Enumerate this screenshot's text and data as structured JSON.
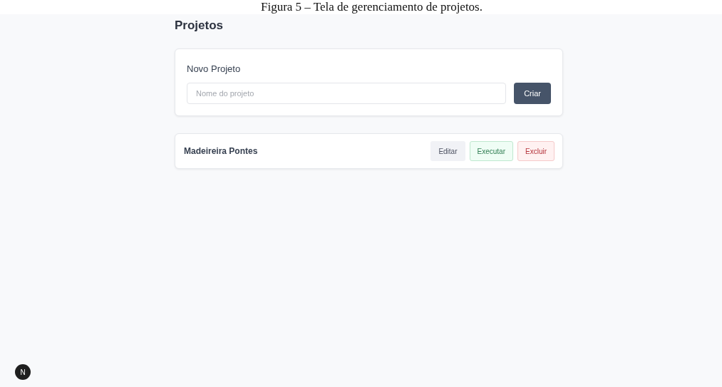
{
  "caption": "Figura 5 – Tela de gerenciamento de projetos.",
  "page_title": "Projetos",
  "new_project": {
    "title": "Novo Projeto",
    "placeholder": "Nome do projeto",
    "button": "Criar"
  },
  "projects": [
    {
      "name": "Madeireira Pontes",
      "actions": [
        {
          "label": "Editar",
          "kind": "neutral"
        },
        {
          "label": "Executar",
          "kind": "success"
        },
        {
          "label": "Excluir",
          "kind": "danger"
        }
      ]
    }
  ],
  "dev_badge": "N"
}
